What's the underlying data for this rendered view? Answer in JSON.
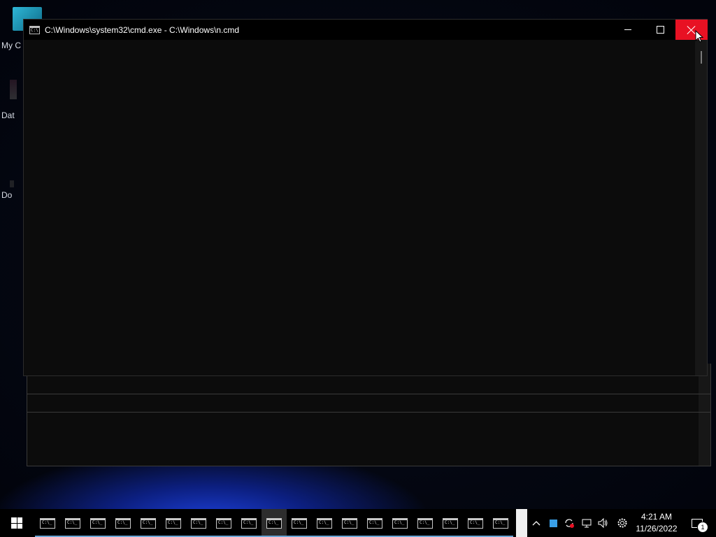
{
  "desktop": {
    "icons": [
      {
        "label": "My C"
      },
      {
        "label": "Dat"
      },
      {
        "label": "Do"
      }
    ]
  },
  "window": {
    "title": "C:\\Windows\\system32\\cmd.exe - C:\\Windows\\n.cmd",
    "icon": "cmd-icon",
    "buttons": {
      "minimize": "minimize-icon",
      "maximize": "maximize-icon",
      "close": "close-icon"
    },
    "close_hover_color": "#e81123",
    "console_background": "#0c0c0c"
  },
  "taskbar": {
    "start_icon": "windows-logo-icon",
    "item_count": 19,
    "item_icon": "cmd-icon",
    "active_index": 9,
    "tray": {
      "icons": [
        "chevron-up-icon",
        "blue-square-icon",
        "sync-icon",
        "network-icon",
        "volume-icon",
        "settings-icon"
      ],
      "time": "4:21 AM",
      "date": "11/26/2022",
      "notification_count": "1"
    }
  }
}
